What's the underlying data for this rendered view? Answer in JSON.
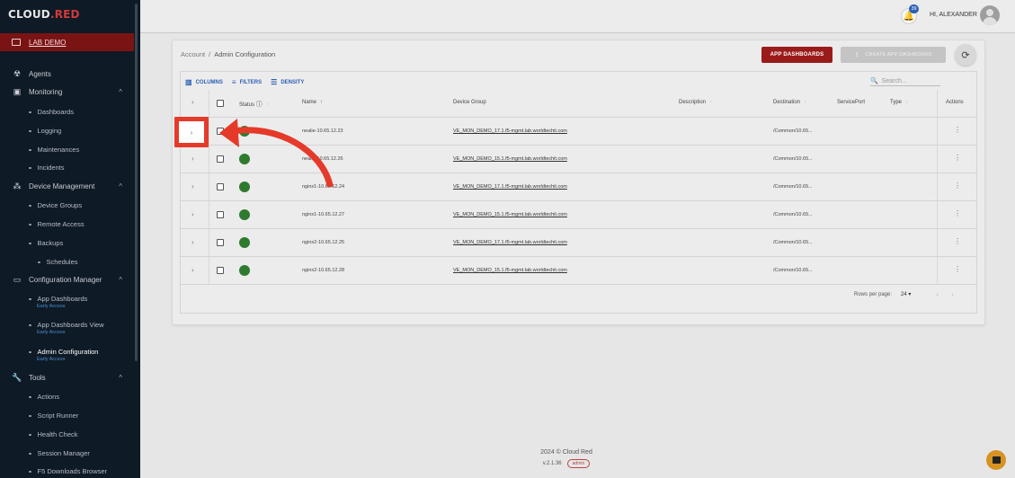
{
  "brand": {
    "logo_main": "CL",
    "logo_mid": "OUD",
    "logo_dot": ".",
    "logo_red": "RED"
  },
  "sidebar": {
    "lab": "LAB DEMO",
    "items": [
      {
        "label": "Agents",
        "icon": "agents-icon"
      },
      {
        "label": "Monitoring",
        "icon": "monitoring-icon"
      },
      {
        "label": "Dashboards"
      },
      {
        "label": "Logging"
      },
      {
        "label": "Maintenances"
      },
      {
        "label": "Incidents"
      },
      {
        "label": "Device Management",
        "icon": "device-management-icon"
      },
      {
        "label": "Device Groups"
      },
      {
        "label": "Remote Access"
      },
      {
        "label": "Backups"
      },
      {
        "label": "Schedules"
      },
      {
        "label": "Configuration Manager",
        "icon": "configuration-manager-icon"
      },
      {
        "label": "App Dashboards",
        "badge": "Early Access"
      },
      {
        "label": "App Dashboards View",
        "badge": "Early Access"
      },
      {
        "label": "Admin Configuration",
        "badge": "Early Access"
      },
      {
        "label": "Tools",
        "icon": "tools-icon"
      },
      {
        "label": "Actions"
      },
      {
        "label": "Script Runner"
      },
      {
        "label": "Health Check"
      },
      {
        "label": "Session Manager"
      },
      {
        "label": "F5 Downloads Browser"
      }
    ]
  },
  "header": {
    "notifications": "39",
    "greeting": "HI, ALEXANDER"
  },
  "breadcrumb": {
    "root": "Account",
    "current": "Admin Configuration"
  },
  "buttons": {
    "app_dashboards": "APP DASHBOARDS",
    "create_app_dashboard": "CREATE APP DASHBOARD"
  },
  "toolbar": {
    "columns": "COLUMNS",
    "filters": "FILTERS",
    "density": "DENSITY",
    "search_placeholder": "Search..."
  },
  "table": {
    "headers": {
      "status": "Status",
      "name": "Name",
      "device_group": "Device Group",
      "description": "Description",
      "destination": "Destination",
      "service_port": "ServicePort",
      "type": "Type",
      "actions": "Actions"
    },
    "rows": [
      {
        "name": "nealie-10.65.12.23",
        "device_group": "VE_MON_DEMO_17.1.f5-mgmt.lab.worldtechit.com",
        "destination": "/Common/10.65..."
      },
      {
        "name": "nealie-10.65.12.26",
        "device_group": "VE_MON_DEMO_15.1.f5-mgmt.lab.worldtechit.com",
        "destination": "/Common/10.65..."
      },
      {
        "name": "nginx1-10.65.12.24",
        "device_group": "VE_MON_DEMO_17.1.f5-mgmt.lab.worldtechit.com",
        "destination": "/Common/10.65..."
      },
      {
        "name": "nginx1-10.65.12.27",
        "device_group": "VE_MON_DEMO_15.1.f5-mgmt.lab.worldtechit.com",
        "destination": "/Common/10.65..."
      },
      {
        "name": "nginx2-10.65.12.25",
        "device_group": "VE_MON_DEMO_17.1.f5-mgmt.lab.worldtechit.com",
        "destination": "/Common/10.65..."
      },
      {
        "name": "nginx2-10.65.12.28",
        "device_group": "VE_MON_DEMO_15.1.f5-mgmt.lab.worldtechit.com",
        "destination": "/Common/10.65..."
      }
    ]
  },
  "pagination": {
    "label": "Rows per page:",
    "value": "24"
  },
  "footer": {
    "copyright": "2024 © Cloud Red",
    "version": "v.2.1.36",
    "role": "admin"
  },
  "colors": {
    "brand_red": "#9b1b1b",
    "status_green": "#2f7a2f",
    "accent_blue": "#2c5fb5",
    "annotation_red": "#e53a2a"
  }
}
